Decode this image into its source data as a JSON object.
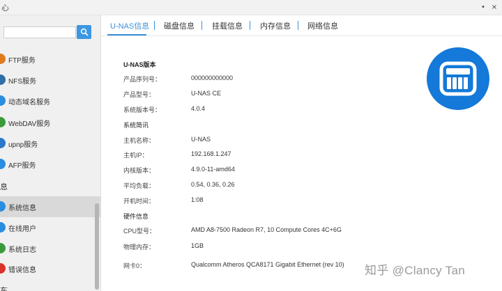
{
  "window": {
    "app_glyph": "心",
    "minimize_glyph": "•",
    "close_glyph": "×"
  },
  "sidebar": {
    "search": {
      "value": "",
      "placeholder": ""
    },
    "items_top": [
      {
        "label": "FTP服务",
        "icon": "ftp-icon",
        "color": "#e07a1f"
      },
      {
        "label": "NFS服务",
        "icon": "nfs-icon",
        "color": "#2f6fa8"
      },
      {
        "label": "动态域名服务",
        "icon": "ddns-icon",
        "color": "#2a8de0"
      },
      {
        "label": "WebDAV服务",
        "icon": "webdav-icon",
        "color": "#3a9a3a"
      },
      {
        "label": "upnp服务",
        "icon": "upnp-icon",
        "color": "#2a78c7"
      },
      {
        "label": "AFP服务",
        "icon": "afp-icon",
        "color": "#2a8de0"
      }
    ],
    "group_info": "息",
    "items_info": [
      {
        "label": "系统信息",
        "icon": "system-info-icon",
        "color": "#2a8de0",
        "active": true
      },
      {
        "label": "在线用户",
        "icon": "online-users-icon",
        "color": "#2a8de0",
        "active": false
      },
      {
        "label": "系统日志",
        "icon": "system-log-icon",
        "color": "#3a9a3a",
        "active": false
      },
      {
        "label": "错误信息",
        "icon": "error-info-icon",
        "color": "#d9332b",
        "active": false
      }
    ],
    "group_bottom": "东"
  },
  "tabs": [
    {
      "label": "U-NAS信息",
      "active": true
    },
    {
      "label": "磁盘信息",
      "active": false
    },
    {
      "label": "挂载信息",
      "active": false
    },
    {
      "label": "内存信息",
      "active": false
    },
    {
      "label": "网络信息",
      "active": false
    }
  ],
  "info": {
    "version_title": "U-NAS版本",
    "version_rows": [
      {
        "label": "产品序列号：",
        "value": "000000000000"
      },
      {
        "label": "产品型号：",
        "value": "U-NAS CE"
      },
      {
        "label": "系统版本号：",
        "value": "4.0.4"
      }
    ],
    "system_title": "系统简讯",
    "system_rows": [
      {
        "label": "主机名称：",
        "value": "U-NAS"
      },
      {
        "label": "主机IP：",
        "value": "192.168.1.247"
      },
      {
        "label": "内核版本：",
        "value": "4.9.0-11-amd64"
      },
      {
        "label": "平均负载：",
        "value": "0.54, 0.36, 0.26"
      },
      {
        "label": "开机时间：",
        "value": "1:08"
      }
    ],
    "hardware_title": "硬件信息",
    "hardware_rows": [
      {
        "label": "CPU型号：",
        "value": "AMD A8-7500 Radeon R7, 10 Compute Cores 4C+6G"
      },
      {
        "label": "物理内存：",
        "value": "1GB"
      },
      {
        "label": "网卡0：",
        "value": "Qualcomm Atheros QCA8171 Gigabit Ethernet (rev 10)"
      }
    ]
  },
  "watermark": "知乎 @Clancy Tan",
  "colors": {
    "accent": "#3d8fd8",
    "logo_bg": "#1479d8"
  }
}
